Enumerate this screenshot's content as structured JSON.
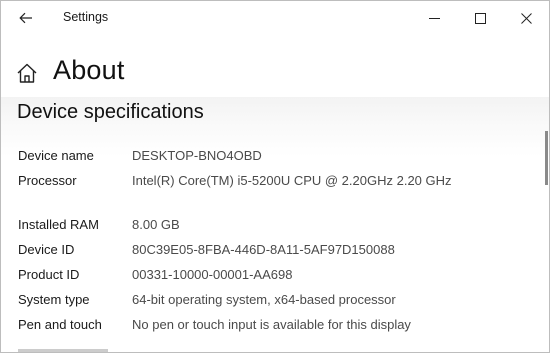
{
  "window": {
    "title": "Settings"
  },
  "header": {
    "title": "About"
  },
  "section": {
    "title": "Device specifications"
  },
  "specs": [
    {
      "label": "Device name",
      "value": "DESKTOP-BNO4OBD"
    },
    {
      "label": "Processor",
      "value": "Intel(R) Core(TM) i5-5200U CPU @ 2.20GHz   2.20 GHz"
    },
    {
      "label": "Installed RAM",
      "value": "8.00 GB"
    },
    {
      "label": "Device ID",
      "value": "80C39E05-8FBA-446D-8A11-5AF97D150088"
    },
    {
      "label": "Product ID",
      "value": "00331-10000-00001-AA698"
    },
    {
      "label": "System type",
      "value": "64-bit operating system, x64-based processor"
    },
    {
      "label": "Pen and touch",
      "value": "No pen or touch input is available for this display"
    }
  ],
  "icons": {
    "back": "back-arrow-icon",
    "home": "home-icon",
    "minimize": "minimize-icon",
    "maximize": "maximize-icon",
    "close": "close-icon"
  }
}
